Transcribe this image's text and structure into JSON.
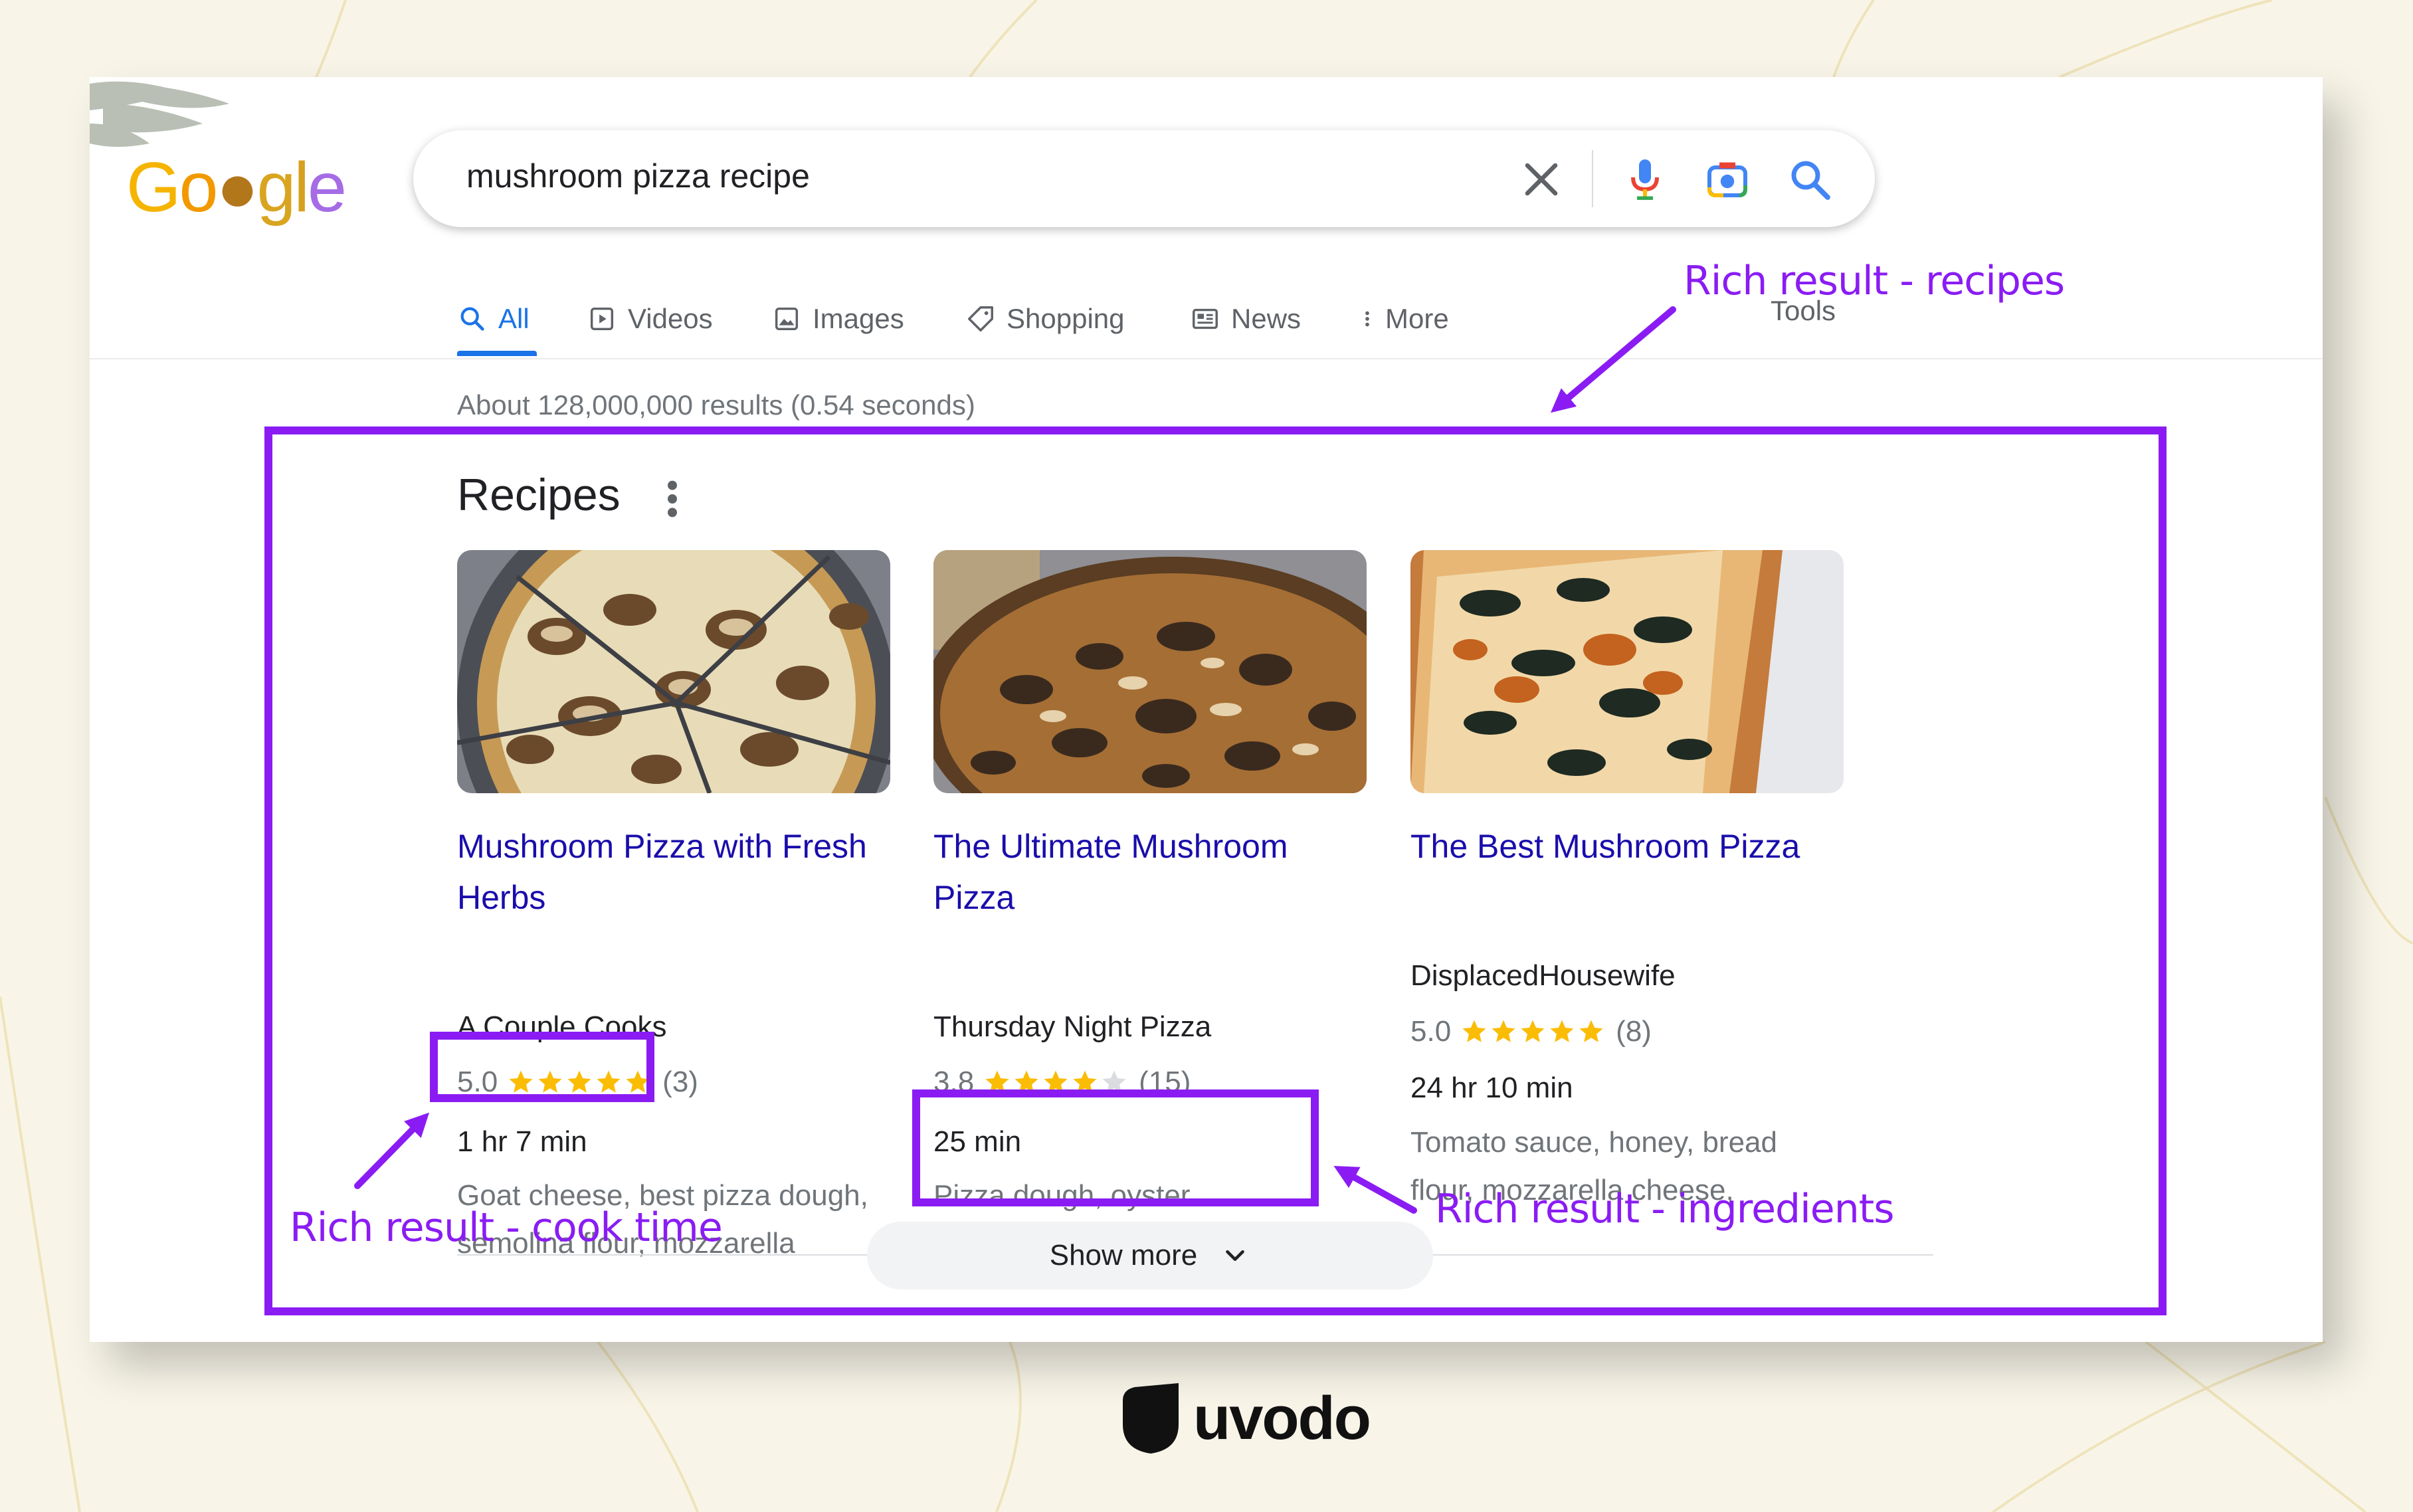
{
  "colors": {
    "background": "#f8f5e8",
    "annotation": "#8a1cf3",
    "link": "#1a0dab",
    "active_tab": "#1a73e8",
    "star": "#fbbc04"
  },
  "logo": {
    "text": "Google"
  },
  "search": {
    "query": "mushroom pizza recipe",
    "icons": [
      "close-icon",
      "mic-icon",
      "camera-icon",
      "search-icon"
    ]
  },
  "tabs": [
    {
      "label": "All",
      "icon": "search-icon",
      "active": true
    },
    {
      "label": "Videos",
      "icon": "play-icon"
    },
    {
      "label": "Images",
      "icon": "image-icon"
    },
    {
      "label": "Shopping",
      "icon": "tag-icon"
    },
    {
      "label": "News",
      "icon": "news-icon"
    },
    {
      "label": "More",
      "icon": "more-vert-icon"
    }
  ],
  "tools_label": "Tools",
  "result_stats": "About 128,000,000 results (0.54 seconds)",
  "recipes": {
    "title": "Recipes",
    "items": [
      {
        "title": "Mushroom Pizza with Fresh Herbs",
        "source": "A Couple Cooks",
        "rating": "5.0",
        "stars": 5,
        "count": "(3)",
        "time": "1 hr 7 min",
        "ingredients": "Goat cheese, best pizza dough, semolina flour, mozzarella"
      },
      {
        "title": "The Ultimate Mushroom Pizza",
        "source": "Thursday Night Pizza",
        "rating": "3.8",
        "stars": 4,
        "count": "(15)",
        "time": "25 min",
        "ingredients": "Pizza dough, oyster mushrooms, aged gouda"
      },
      {
        "title": "The Best Mushroom Pizza",
        "source": "DisplacedHousewife",
        "rating": "5.0",
        "stars": 5,
        "count": "(8)",
        "time": "24 hr 10 min",
        "ingredients": "Tomato sauce, honey, bread flour, mozzarella cheese,"
      }
    ],
    "show_more": "Show more"
  },
  "annotations": {
    "recipes": "Rich result - recipes",
    "cook_time": "Rich result - cook time",
    "ingredients": "Rich result - ingredients"
  },
  "brand": {
    "name": "uvodo"
  }
}
